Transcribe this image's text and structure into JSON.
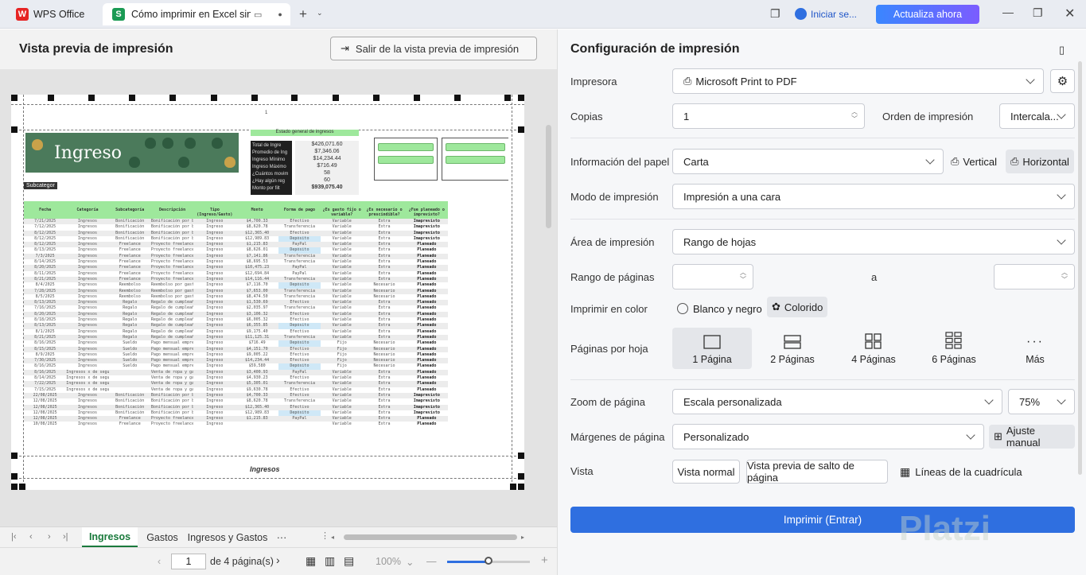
{
  "titlebar": {
    "app_tab": "WPS Office",
    "doc_tab": "Cómo imprimir en Excel sin e",
    "login": "Iniciar se...",
    "upgrade": "Actualiza ahora"
  },
  "left": {
    "title": "Vista previa de impresión",
    "exit_button": "Salir de la vista previa de impresión"
  },
  "sheet_preview": {
    "page_number": "1",
    "banner_title": "Ingreso",
    "subtag": "Subcategor",
    "summary_header": "Estado general de ingresos",
    "summary_labels": [
      "Total de Ingre",
      "Promedio de Ing",
      "Ingreso Mínimo",
      "Ingreso Máximo",
      "¿Cuántos movim",
      "¿Hay algún reg",
      "Monto por filt"
    ],
    "summary_values": [
      "$426,071.60",
      "$7,346.06",
      "$14,234.44",
      "$716.49",
      "58",
      "60",
      "$939,075.40"
    ],
    "columns": [
      "Fecha",
      "Categoría",
      "Subcategoría",
      "Descripción",
      "Tipo (Ingreso/Gasto)",
      "Monto",
      "Forma de pago",
      "¿Es gasto fijo o variable?",
      "¿Es necesario o prescindible?",
      "¿Fue planeado o imprevisto?"
    ],
    "rows": [
      [
        "7/21/2025",
        "Ingresos",
        "Bonificación",
        "Bonificación por buen desempeño",
        "Ingreso",
        "$4,700.33",
        "Efectivo",
        "Variable",
        "Extra",
        "Imaprevisto"
      ],
      [
        "7/12/2025",
        "Ingresos",
        "Bonificación",
        "Bonificación por buen desempeño",
        "Ingreso",
        "$8,620.78",
        "Transferencia",
        "Variable",
        "Extra",
        "Imaprevisto"
      ],
      [
        "8/12/2025",
        "Ingresos",
        "Bonificación",
        "Bonificación por buen desempeño",
        "Ingreso",
        "$12,365.40",
        "Efectivo",
        "Variable",
        "Extra",
        "Imaprevisto"
      ],
      [
        "8/12/2025",
        "Ingresos",
        "Bonificación",
        "Bonificación por buen desempeño",
        "Ingreso",
        "$12,989.83",
        "Depósito",
        "Variable",
        "Extra",
        "Imaprevisto"
      ],
      [
        "8/12/2025",
        "Ingresos",
        "Freelance",
        "Proyecto freelance UX para startup",
        "Ingreso",
        "$1,215.83",
        "PayPal",
        "Variable",
        "Extra",
        "Planeado"
      ],
      [
        "8/13/2025",
        "Ingresos",
        "Freelance",
        "Proyecto freelance UX para startup",
        "Ingreso",
        "$8,626.01",
        "Depósito",
        "Variable",
        "Extra",
        "Planeado"
      ],
      [
        "7/3/2025",
        "Ingresos",
        "Freelance",
        "Proyecto freelance UX para startup",
        "Ingreso",
        "$7,141.86",
        "Transferencia",
        "Variable",
        "Extra",
        "Planeado"
      ],
      [
        "8/14/2025",
        "Ingresos",
        "Freelance",
        "Proyecto freelance UX para startup",
        "Ingreso",
        "$8,695.53",
        "Transferencia",
        "Variable",
        "Extra",
        "Planeado"
      ],
      [
        "8/20/2025",
        "Ingresos",
        "Freelance",
        "Proyecto freelance UX para startup",
        "Ingreso",
        "$10,475.23",
        "PayPal",
        "Variable",
        "Extra",
        "Planeado"
      ],
      [
        "8/11/2025",
        "Ingresos",
        "Freelance",
        "Proyecto freelance UX para startup",
        "Ingreso",
        "$12,694.84",
        "PayPal",
        "Variable",
        "Extra",
        "Planeado"
      ],
      [
        "8/21/2025",
        "Ingresos",
        "Freelance",
        "Proyecto freelance UX para startup",
        "Ingreso",
        "$14,116.44",
        "Transferencia",
        "Variable",
        "Extra",
        "Planeado"
      ],
      [
        "8/4/2025",
        "Ingresos",
        "Reembolso",
        "Reembolso por gastos de trabajo",
        "Ingreso",
        "$7,116.70",
        "Depósito",
        "Variable",
        "Necesario",
        "Planeado"
      ],
      [
        "7/28/2025",
        "Ingresos",
        "Reembolso",
        "Reembolso por gastos de trabajo",
        "Ingreso",
        "$7,653.00",
        "Transferencia",
        "Variable",
        "Necesario",
        "Planeado"
      ],
      [
        "8/5/2025",
        "Ingresos",
        "Reembolso",
        "Reembolso por gastos de trabajo",
        "Ingreso",
        "$8,474.50",
        "Transferencia",
        "Variable",
        "Necesario",
        "Planeado"
      ],
      [
        "8/13/2025",
        "Ingresos",
        "Regalo",
        "Regalo de cumpleaños de papás",
        "Ingreso",
        "$1,530.69",
        "Efectivo",
        "Variable",
        "Extra",
        "Planeado"
      ],
      [
        "7/16/2025",
        "Ingresos",
        "Regalo",
        "Regalo de cumpleaños de papás",
        "Ingreso",
        "$2,035.97",
        "Transferencia",
        "Variable",
        "Extra",
        "Planeado"
      ],
      [
        "8/20/2025",
        "Ingresos",
        "Regalo",
        "Regalo de cumpleaños de papás",
        "Ingreso",
        "$3,106.32",
        "Efectivo",
        "Variable",
        "Extra",
        "Planeado"
      ],
      [
        "8/18/2025",
        "Ingresos",
        "Regalo",
        "Regalo de cumpleaños de papás",
        "Ingreso",
        "$6,005.32",
        "Efectivo",
        "Variable",
        "Extra",
        "Planeado"
      ],
      [
        "8/13/2025",
        "Ingresos",
        "Regalo",
        "Regalo de cumpleaños de papás",
        "Ingreso",
        "$6,355.85",
        "Depósito",
        "Variable",
        "Extra",
        "Planeado"
      ],
      [
        "8/1/2025",
        "Ingresos",
        "Regalo",
        "Regalo de cumpleaños de papás",
        "Ingreso",
        "$9,175.40",
        "Efectivo",
        "Variable",
        "Extra",
        "Planeado"
      ],
      [
        "8/21/2025",
        "Ingresos",
        "Regalo",
        "Regalo de cumpleaños de papás",
        "Ingreso",
        "$11,125.31",
        "Transferencia",
        "Variable",
        "Extra",
        "Planeado"
      ],
      [
        "8/16/2025",
        "Ingresos",
        "Sueldo",
        "Pago mensual empresa XXCorp",
        "Ingreso",
        "$716.49",
        "Depósito",
        "Fijo",
        "Necesario",
        "Planeado"
      ],
      [
        "8/15/2025",
        "Ingresos",
        "Sueldo",
        "Pago mensual empresa XXCorp",
        "Ingreso",
        "$4,151.70",
        "Efectivo",
        "Fijo",
        "Necesario",
        "Planeado"
      ],
      [
        "8/9/2025",
        "Ingresos",
        "Sueldo",
        "Pago mensual empresa XXCorp",
        "Ingreso",
        "$9,005.22",
        "Efectivo",
        "Fijo",
        "Necesario",
        "Planeado"
      ],
      [
        "7/30/2025",
        "Ingresos",
        "Sueldo",
        "Pago mensual empresa XXCorp",
        "Ingreso",
        "$14,234.44",
        "Efectivo",
        "Fijo",
        "Necesario",
        "Planeado"
      ],
      [
        "8/16/2025",
        "Ingresos",
        "Sueldo",
        "Pago mensual empresa XXCorp",
        "Ingreso",
        "$59,580",
        "Depósito",
        "Fijo",
        "Necesario",
        "Planeado"
      ],
      [
        "8/16/2025",
        "Ingresos x de segunda mano",
        "",
        "Venta de ropa y gadgets usados",
        "Ingreso",
        "$3,400.93",
        "PayPal",
        "Variable",
        "Extra",
        "Planeado"
      ],
      [
        "8/14/2025",
        "Ingresos x de segunda mano",
        "",
        "Venta de ropa y gadgets usados",
        "Ingreso",
        "$4,930.23",
        "Efectivo",
        "Variable",
        "Extra",
        "Planeado"
      ],
      [
        "7/22/2025",
        "Ingresos x de segunda mano",
        "",
        "Venta de ropa y gadgets usados",
        "Ingreso",
        "$5,305.01",
        "Transferencia",
        "Variable",
        "Extra",
        "Planeado"
      ],
      [
        "7/15/2025",
        "Ingresos x de segunda mano",
        "",
        "Venta de ropa y gadgets usados",
        "Ingreso",
        "$9,630.78",
        "Efectivo",
        "Variable",
        "Extra",
        "Planeado"
      ],
      [
        "22/08/2025",
        "Ingresos",
        "Bonificación",
        "Bonificación por buen desempeño",
        "Ingreso",
        "$4,700.33",
        "Efectivo",
        "Variable",
        "Extra",
        "Imaprevisto"
      ],
      [
        "12/08/2025",
        "Ingresos",
        "Bonificación",
        "Bonificación por buen desempeño",
        "Ingreso",
        "$8,620.78",
        "Transferencia",
        "Variable",
        "Extra",
        "Imaprevisto"
      ],
      [
        "12/08/2025",
        "Ingresos",
        "Bonificación",
        "Bonificación por buen desempeño",
        "Ingreso",
        "$12,365.40",
        "Efectivo",
        "Variable",
        "Extra",
        "Imaprevisto"
      ],
      [
        "12/08/2025",
        "Ingresos",
        "Bonificación",
        "Bonificación por buen desempeño",
        "Ingreso",
        "$12,989.83",
        "Depósito",
        "Variable",
        "Extra",
        "Imaprevisto"
      ],
      [
        "12/08/2025",
        "Ingresos",
        "Freelance",
        "Proyecto freelance UX para startup",
        "Ingreso",
        "$1,215.83",
        "PayPal",
        "Variable",
        "Extra",
        "Planeado"
      ],
      [
        "10/08/2025",
        "Ingresos",
        "Freelance",
        "Proyecto freelance UX para startup",
        "Ingreso",
        "",
        "",
        "Variable",
        "Extra",
        "Planeado"
      ]
    ],
    "footer": "Ingresos"
  },
  "sheet_tabs": [
    "Ingresos",
    "Gastos",
    "Ingresos y Gastos"
  ],
  "more_tabs": "···",
  "statusbar": {
    "page_value": "1",
    "page_of": "de 4 página(s)",
    "zoom": "100%"
  },
  "right": {
    "title": "Configuración de impresión",
    "printer_label": "Impresora",
    "printer_value": "Microsoft Print to PDF",
    "copies_label": "Copias",
    "copies_value": "1",
    "order_label": "Orden de impresión",
    "order_value": "Intercala...",
    "paper_label": "Información del papel",
    "paper_value": "Carta",
    "portrait": "Vertical",
    "landscape": "Horizontal",
    "mode_label": "Modo de impresión",
    "mode_value": "Impresión a una cara",
    "area_label": "Área de impresión",
    "area_value": "Rango de hojas",
    "range_label": "Rango de páginas",
    "range_to": "a",
    "color_label": "Imprimir en color",
    "bw": "Blanco y negro",
    "color": "Colorido",
    "pps_label": "Páginas por hoja",
    "pps_options": [
      "1 Página",
      "2 Páginas",
      "4 Páginas",
      "6 Páginas",
      "Más"
    ],
    "zoom_label": "Zoom de página",
    "zoom_mode": "Escala personalizada",
    "zoom_value": "75%",
    "margins_label": "Márgenes de página",
    "margins_value": "Personalizado",
    "manual_adjust": "Ajuste manual",
    "view_label": "Vista",
    "normal_view": "Vista normal",
    "page_break_view": "Vista previa de salto de página",
    "gridlines": "Líneas de la cuadrícula",
    "print_button": "Imprimir (Entrar)"
  },
  "watermark": "Platzi",
  "colors": {
    "accent": "#2f6fe0",
    "sheet_green": "#1a7a3c",
    "banner": "#4b7a5b",
    "header_green": "#9ee89c"
  }
}
